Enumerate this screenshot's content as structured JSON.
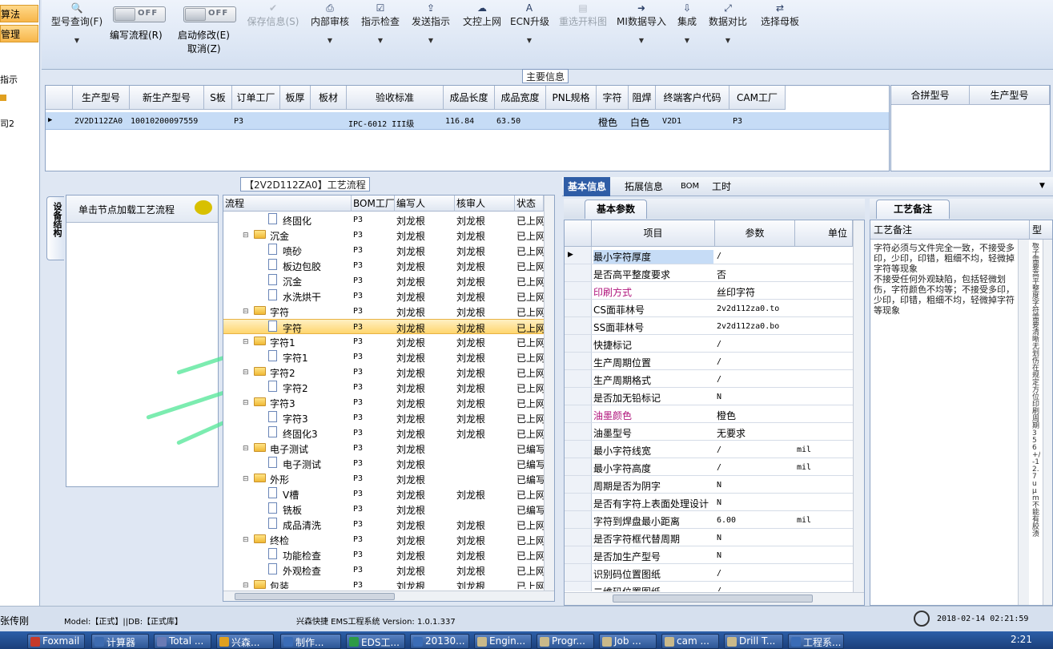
{
  "left_strip": {
    "item1": "算法",
    "item2": "管理",
    "text1": "指示",
    "text2": "司2"
  },
  "ribbon": {
    "query": "型号查询(F)",
    "edit_flow_label": "编写流程(R)",
    "start_modify_label": "启动修改(E)",
    "cancel_label": "取消(Z)",
    "toggle_off": "OFF",
    "save": "保存信息(S)",
    "internal_review": "内部审核",
    "indicator_check": "指示检查",
    "send_indicator": "发送指示",
    "doc_upload": "文控上网",
    "ecn_upgrade": "ECN升级",
    "regen_cut": "重选开料图",
    "mi_import": "MI数据导入",
    "integrate": "集成",
    "data_compare": "数据对比",
    "select_master": "选择母板"
  },
  "main_info": {
    "title": "主要信息",
    "columns": [
      "生产型号",
      "新生产型号",
      "S板",
      "订单工厂",
      "板厚",
      "板材",
      "验收标准",
      "成品长度",
      "成品宽度",
      "PNL规格",
      "字符",
      "阻焊",
      "终端客户代码",
      "CAM工厂"
    ],
    "row": [
      "2V2D112ZA0",
      "10010200097559",
      "",
      "P3",
      "",
      "",
      "IPC-6012 III级",
      "116.84",
      "63.50",
      "",
      "橙色",
      "白色",
      "V2D1",
      "P3"
    ],
    "side_columns": [
      "合拼型号",
      "生产型号"
    ]
  },
  "process": {
    "title": "【2V2D112ZA0】工艺流程",
    "vtab": "设备结构",
    "hint": "单击节点加载工艺流程",
    "columns": [
      "流程",
      "BOM工厂",
      "编写人",
      "核审人",
      "状态"
    ],
    "rows": [
      {
        "level": 2,
        "name": "终固化",
        "bom": "P3",
        "writer": "刘龙根",
        "reviewer": "刘龙根",
        "status": "已上网"
      },
      {
        "level": 1,
        "name": "沉金",
        "bom": "P3",
        "writer": "刘龙根",
        "reviewer": "刘龙根",
        "status": "已上网"
      },
      {
        "level": 2,
        "name": "喷砂",
        "bom": "P3",
        "writer": "刘龙根",
        "reviewer": "刘龙根",
        "status": "已上网"
      },
      {
        "level": 2,
        "name": "板边包胶",
        "bom": "P3",
        "writer": "刘龙根",
        "reviewer": "刘龙根",
        "status": "已上网"
      },
      {
        "level": 2,
        "name": "沉金",
        "bom": "P3",
        "writer": "刘龙根",
        "reviewer": "刘龙根",
        "status": "已上网"
      },
      {
        "level": 2,
        "name": "水洗烘干",
        "bom": "P3",
        "writer": "刘龙根",
        "reviewer": "刘龙根",
        "status": "已上网"
      },
      {
        "level": 1,
        "name": "字符",
        "bom": "P3",
        "writer": "刘龙根",
        "reviewer": "刘龙根",
        "status": "已上网"
      },
      {
        "level": 2,
        "name": "字符",
        "bom": "P3",
        "writer": "刘龙根",
        "reviewer": "刘龙根",
        "status": "已上网",
        "selected": true
      },
      {
        "level": 1,
        "name": "字符1",
        "bom": "P3",
        "writer": "刘龙根",
        "reviewer": "刘龙根",
        "status": "已上网"
      },
      {
        "level": 2,
        "name": "字符1",
        "bom": "P3",
        "writer": "刘龙根",
        "reviewer": "刘龙根",
        "status": "已上网"
      },
      {
        "level": 1,
        "name": "字符2",
        "bom": "P3",
        "writer": "刘龙根",
        "reviewer": "刘龙根",
        "status": "已上网"
      },
      {
        "level": 2,
        "name": "字符2",
        "bom": "P3",
        "writer": "刘龙根",
        "reviewer": "刘龙根",
        "status": "已上网"
      },
      {
        "level": 1,
        "name": "字符3",
        "bom": "P3",
        "writer": "刘龙根",
        "reviewer": "刘龙根",
        "status": "已上网"
      },
      {
        "level": 2,
        "name": "字符3",
        "bom": "P3",
        "writer": "刘龙根",
        "reviewer": "刘龙根",
        "status": "已上网"
      },
      {
        "level": 2,
        "name": "终固化3",
        "bom": "P3",
        "writer": "刘龙根",
        "reviewer": "刘龙根",
        "status": "已上网"
      },
      {
        "level": 1,
        "name": "电子测试",
        "bom": "P3",
        "writer": "刘龙根",
        "reviewer": "",
        "status": "已编写"
      },
      {
        "level": 2,
        "name": "电子测试",
        "bom": "P3",
        "writer": "刘龙根",
        "reviewer": "",
        "status": "已编写"
      },
      {
        "level": 1,
        "name": "外形",
        "bom": "P3",
        "writer": "刘龙根",
        "reviewer": "",
        "status": "已编写"
      },
      {
        "level": 2,
        "name": "V槽",
        "bom": "P3",
        "writer": "刘龙根",
        "reviewer": "刘龙根",
        "status": "已上网"
      },
      {
        "level": 2,
        "name": "铣板",
        "bom": "P3",
        "writer": "刘龙根",
        "reviewer": "",
        "status": "已编写"
      },
      {
        "level": 2,
        "name": "成品清洗",
        "bom": "P3",
        "writer": "刘龙根",
        "reviewer": "刘龙根",
        "status": "已上网"
      },
      {
        "level": 1,
        "name": "终检",
        "bom": "P3",
        "writer": "刘龙根",
        "reviewer": "刘龙根",
        "status": "已上网"
      },
      {
        "level": 2,
        "name": "功能检查",
        "bom": "P3",
        "writer": "刘龙根",
        "reviewer": "刘龙根",
        "status": "已上网"
      },
      {
        "level": 2,
        "name": "外观检查",
        "bom": "P3",
        "writer": "刘龙根",
        "reviewer": "刘龙根",
        "status": "已上网"
      },
      {
        "level": 1,
        "name": "包装",
        "bom": "P3",
        "writer": "刘龙根",
        "reviewer": "刘龙根",
        "status": "已上网"
      }
    ]
  },
  "right_tabs": [
    "基本信息",
    "拓展信息",
    "BOM",
    "工时"
  ],
  "basic_params": {
    "tab": "基本参数",
    "columns": [
      "项目",
      "参数",
      "单位"
    ],
    "rows": [
      {
        "item": "最小字符厚度",
        "param": "/",
        "unit": "",
        "sel": true
      },
      {
        "item": "是否高平整度要求",
        "param": "否",
        "unit": ""
      },
      {
        "item": "印刷方式",
        "param": "丝印字符",
        "unit": "",
        "hl": true
      },
      {
        "item": "CS面菲林号",
        "param": "2v2d112za0.to",
        "unit": ""
      },
      {
        "item": "SS面菲林号",
        "param": "2v2d112za0.bo",
        "unit": ""
      },
      {
        "item": "快捷标记",
        "param": "/",
        "unit": ""
      },
      {
        "item": "生产周期位置",
        "param": "/",
        "unit": ""
      },
      {
        "item": "生产周期格式",
        "param": "/",
        "unit": ""
      },
      {
        "item": "是否加无铅标记",
        "param": "N",
        "unit": ""
      },
      {
        "item": "油墨颜色",
        "param": "橙色",
        "unit": "",
        "hl": true
      },
      {
        "item": "油墨型号",
        "param": "无要求",
        "unit": ""
      },
      {
        "item": "最小字符线宽",
        "param": "/",
        "unit": "mil"
      },
      {
        "item": "最小字符高度",
        "param": "/",
        "unit": "mil"
      },
      {
        "item": "周期是否为阴字",
        "param": "N",
        "unit": ""
      },
      {
        "item": "是否有字符上表面处理设计",
        "param": "N",
        "unit": ""
      },
      {
        "item": "字符到焊盘最小距离",
        "param": "6.00",
        "unit": "mil"
      },
      {
        "item": "是否字符框代替周期",
        "param": "N",
        "unit": ""
      },
      {
        "item": "是否加生产型号",
        "param": "N",
        "unit": ""
      },
      {
        "item": "识别码位置图纸",
        "param": "/",
        "unit": ""
      },
      {
        "item": "二维码位置图纸",
        "param": "/",
        "unit": ""
      }
    ]
  },
  "notes": {
    "tab": "工艺备注",
    "header": "工艺备注",
    "side_header": "型",
    "text": "字符必须与文件完全一致，不接受多印，少印，印错，粗细不均，轻微掉字符等现象\n不接受任何外观缺陷，包括轻微划伤，字符颜色不均等；不接受多印，少印，印错，粗细不均，轻微掉字符等现象",
    "side_text": "板子需要高平整度字符需要清晰无划伤在规定方位印刷周期3 5 6+/-1 2.7uμm不能有胶渍"
  },
  "status": {
    "user": "张传刚",
    "model": "Model:【正式】||DB:【正式库】",
    "system": "兴森快捷 EMS工程系统 Version: 1.0.1.337",
    "datetime": "2018-02-14 02:21:59"
  },
  "taskbar": {
    "items": [
      "Foxmail",
      "计算器",
      "Total ...",
      "兴森...",
      "制作...",
      "EDS工...",
      "20130...",
      "Engin...",
      "Progr...",
      "Job ...",
      "cam ...",
      "Drill T...",
      "工程系..."
    ],
    "time": "2:21"
  },
  "colors": {
    "accent": "#2f5da6",
    "highlight_text": "#b0147c"
  }
}
